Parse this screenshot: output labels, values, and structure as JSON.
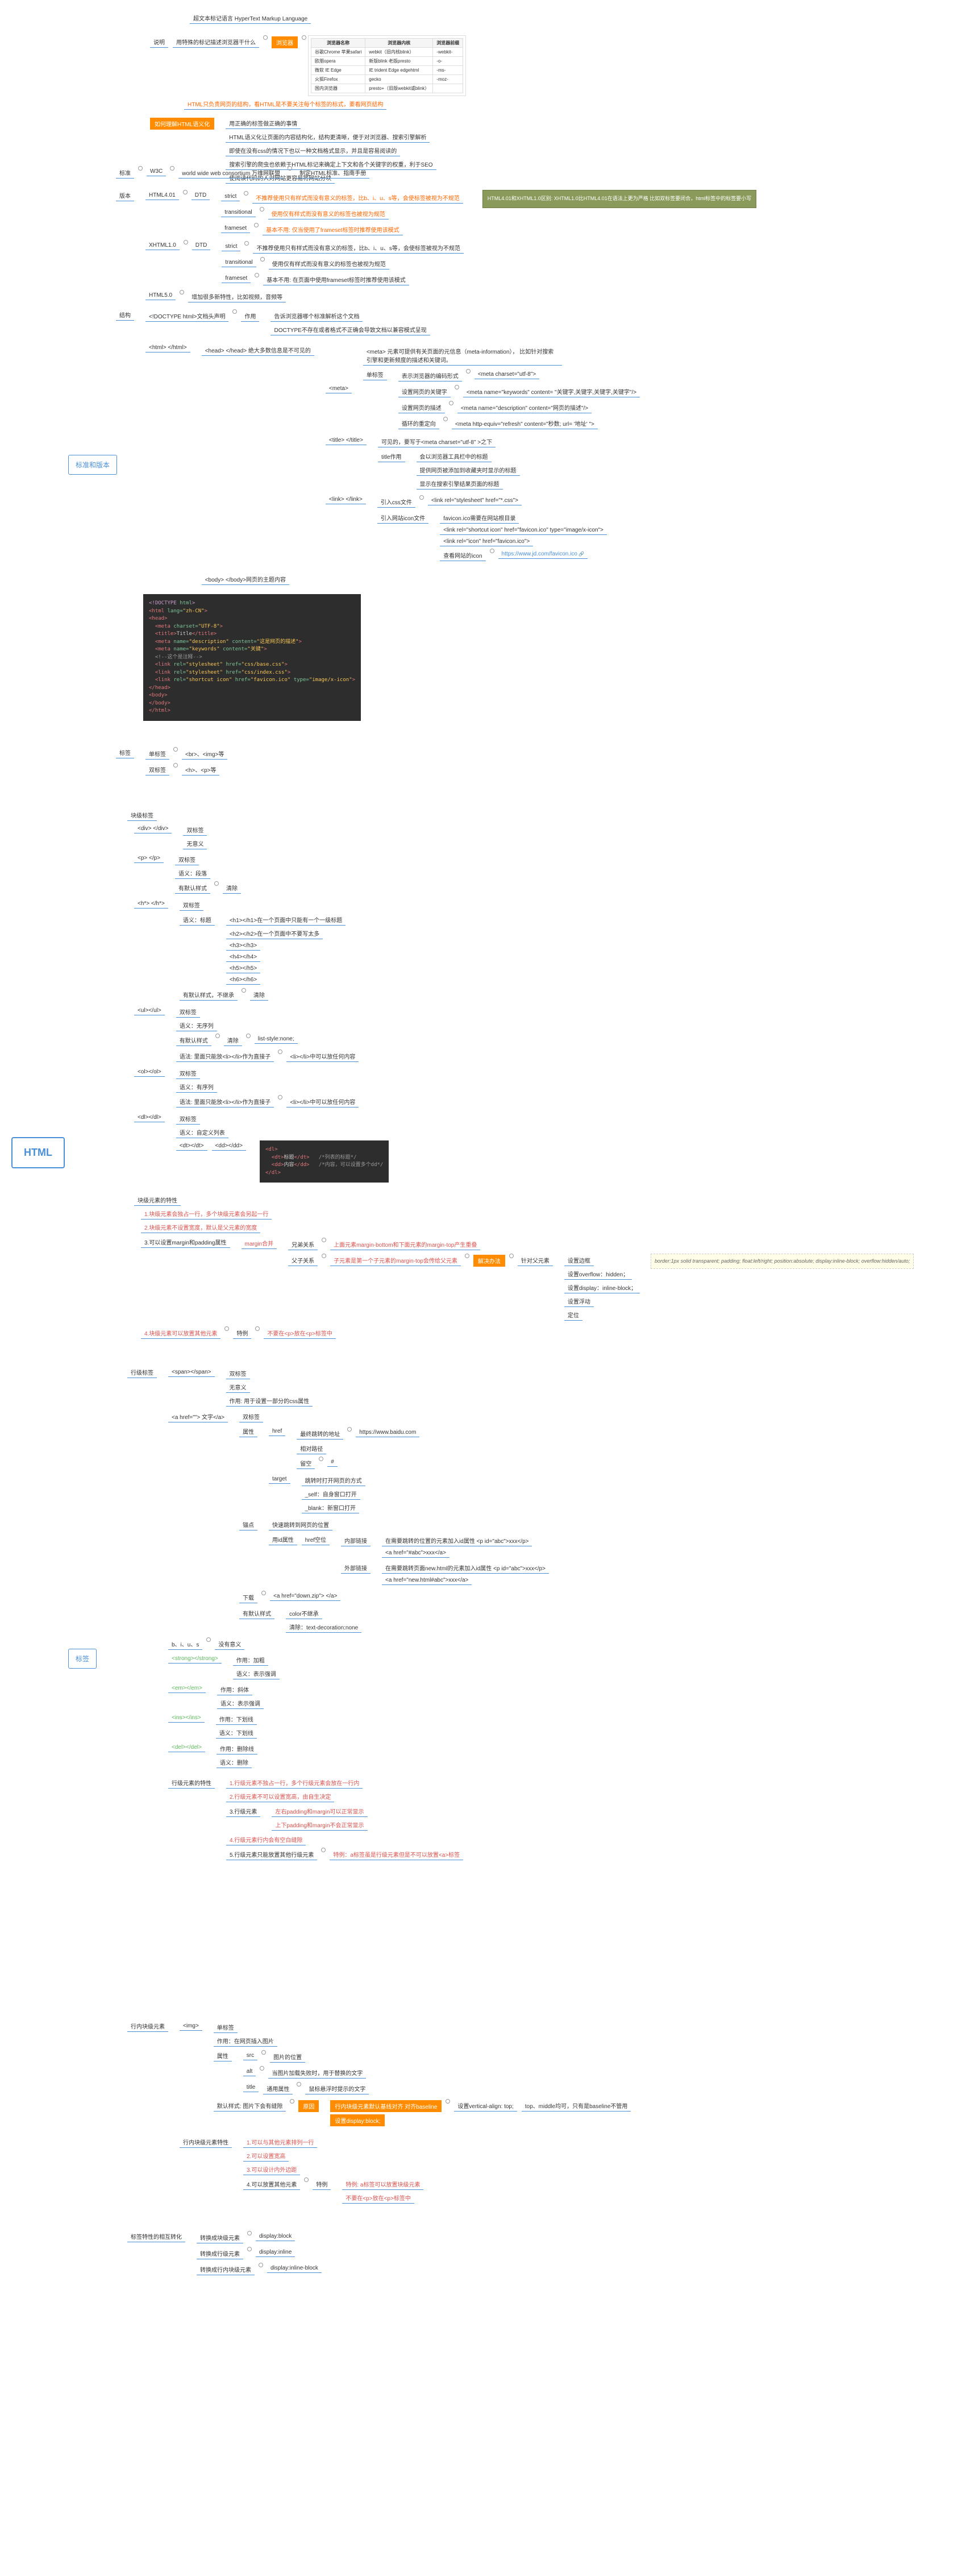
{
  "root": "HTML",
  "main_branches": {
    "standards": "标准和版本",
    "tags": "标签"
  },
  "standards": {
    "title": "超文本标记语言 HyperText Markup Language",
    "desc_label": "说明",
    "desc": "用特殊的标记描述浏览器干什么",
    "browser_btn": "浏览器",
    "browser_note": "HTML只负责网页的结构，看HTML是不要关注每个标签的标式，要看网页结构",
    "how_understand": "如何理解HTML语义化",
    "semantic": {
      "l1": "用正确的标签做正确的事情",
      "l2": "HTML语义化让页面的内容结构化，结构更清晰，便于对浏览器、搜索引擎解析",
      "l3": "即使在没有css的情况下也以一种文档格式显示，并且是容易阅读的",
      "l4": "搜索引擎的爬虫也依赖于HTML标记来确定上下文和各个关键字的权重，利于SEO",
      "l5": "使阅读代码的人对网站更容易将网站分块"
    },
    "std_label": "标准",
    "w3c": "W3C",
    "w3c_full": "world wide web consortium 万维网联盟",
    "std_desc": "制定HTML标准、指南手册",
    "ver_label": "版本",
    "html401": "HTML4.01",
    "xhtml10": "XHTML1.0",
    "html50": "HTML5.0",
    "dtd": "DTD",
    "dtd_items": {
      "strict": "strict",
      "strict_desc": "不推荐使用只有样式而没有意义的标签，比b、i、u、s等，会使标签被视为不规范",
      "transitional": "transitional",
      "trans_desc": "使用仅有样式而没有意义的标签也被视为规范",
      "trans_note": "基本不用: 仅当使用了frameset标签时推荐使用该模式",
      "frameset": "frameset",
      "xstrict_desc": "不推荐使用只有样式而没有意义的标签，比b、i、u、s等，会使标签被视为不规范",
      "xtrans_desc": "使用仅有样式而没有意义的标签也被视为规范",
      "xframe_desc": "基本不用: 在页面中使用frameset标签时推荐使用该模式"
    },
    "html5_desc": "增加很多新特性，比如视频，音频等",
    "green_note": "HTML4.01和XHTML1.0区别:\nXHTML1.0比HTML4.01在语法上更为严格\n比如双标签要闭合，html标签中的标签要小写",
    "struct_label": "结构",
    "doctype": "<!DOCTYPE html>文档头声明",
    "doctype_use": "作用",
    "doctype_d1": "告诉浏览器哪个标准解析这个文档",
    "doctype_d2": "DOCTYPE不存在或者格式不正确会导致文档以兼容模式呈现",
    "html_tag": "<html> </html>",
    "head_tag": "<head> </head> 绝大多数信息是不可见的",
    "body_tag": "<body> </body>网页的主题内容",
    "meta_tag": "<meta>",
    "meta_desc": "<meta> 元素可提供有关页面的元信息（meta-information），\n比如针对搜索引擎和更新频度的描述和关键词。",
    "single_tag": "单标签",
    "meta_charset_l": "表示浏览器的编码形式",
    "meta_charset_v": "<meta charset=\"utf-8\">",
    "meta_kw_l": "设置网页的关键字",
    "meta_kw_v": "<meta name=\"keywords\" content= \"关键字,关键字,关键字,关键字\"/>",
    "meta_desc_l": "设置网页的描述",
    "meta_desc_v": "<meta name=\"description\" content=\"网页的描述\"/>",
    "meta_refresh_l": "循环的重定向",
    "meta_refresh_v": "<meta http-equiv=\"refresh\" content=\"秒数; url= '地址' \">",
    "title_tag": "<title> </title>",
    "title_l1": "可见的，要写于<meta charset=\"utf-8\" >之下",
    "title_d1": "会以浏览器工具栏中的标题",
    "title_label": "title作用",
    "title_d2": "提供网页被添加到收藏夹时显示的标题",
    "title_d3": "显示在搜索引擎结果页面的标题",
    "link_tag": "<link> </link>",
    "link_css_l": "引入css文件",
    "link_css_v": "<link rel=\"stylesheet\" href=\"*.css\">",
    "link_fav_l": "引入网站icon文件",
    "link_fav_d": "favicon.ico需要在网站根目录",
    "link_fav_v1": "<link rel=\"shortcut icon\" href=\"favicon.ico\" type=\"image/x-icon\">",
    "link_fav_v2": "<link rel=\"icon\" href=\"favicon.ico\">",
    "link_fav_see": "查看网站的icon",
    "link_fav_url": "https://www.jd.com/favicon.ico",
    "tag_class_label": "标签",
    "single": "单标签",
    "single_eg": "<br>、<img>等",
    "double": "双标签",
    "double_eg": "<h>、<p>等",
    "browser_table": {
      "headers": [
        "浏览器名称",
        "浏览器内核",
        "浏览器前缀"
      ],
      "rows": [
        [
          "谷歌Chrome 苹果safari",
          "webkit（旧内核blink）",
          "-webkit-"
        ],
        [
          "欧朋opera",
          "新版blink 老版presto",
          "-o-"
        ],
        [
          "微软 IE Edge",
          "IE trident Edge edgehtml",
          "-ms-"
        ],
        [
          "火狐Firefox",
          "gecko",
          "-moz-"
        ],
        [
          "国内浏览器",
          "presto+（旧版webkit或blink）",
          ""
        ]
      ]
    }
  },
  "tags": {
    "block_label": "块级标签",
    "div": {
      "tag": "<div> </div>",
      "t1": "双标签",
      "t2": "无意义"
    },
    "p": {
      "tag": "<p> </p>",
      "t1": "双标签",
      "t2": "语义：段落",
      "d1": "有默认样式",
      "d2": "清除"
    },
    "h": {
      "tag": "<h*> </h*>",
      "t1": "双标签",
      "m": "语义：标题",
      "h1": "<h1></h1>在一个页面中只能有一个一级标题",
      "h2": "<h2></h2>在一个页面中不要写太多",
      "h3": "<h3></h3>",
      "h4": "<h4></h4>",
      "h5": "<h5></h5>",
      "h6": "<h6></h6>",
      "d1": "有默认样式，不继承",
      "d2": "清除"
    },
    "ul": {
      "tag": "<ul></ul>",
      "t1": "双标签",
      "m": "语义：无序列",
      "d1": "有默认样式",
      "d2": "清除",
      "d3": "list-style:none;",
      "n": "语法: 里面只能放<li></li>作为直接子",
      "n2": "<li></li>中可以放任何内容"
    },
    "ol": {
      "tag": "<ol></ol>",
      "t1": "双标签",
      "m": "语义：有序列",
      "n": "语法: 里面只能放<li></li>作为直接子",
      "n2": "<li></li>中可以放任何内容"
    },
    "dl": {
      "tag": "<dl></dl>",
      "t1": "双标签",
      "m": "语义：自定义列表",
      "dt": "<dt></dt>",
      "dd": "<dd></dd>"
    },
    "block_feature_label": "块级元素的特性",
    "bf1": "1.块级元素会独占一行，多个块级元素会另起一行",
    "bf2": "2.块级元素不设置宽度，默认是父元素的宽度",
    "bf3": "3.可以设置margin和padding属性",
    "bf4": "4.块级元素可以放置其他元素",
    "bf4_sp": "特例",
    "bf4_sp_v": "不要在<p>放在<p>标签中",
    "margin_label": "margin合并",
    "margin_bro": "兄弟关系",
    "margin_bro_v": "上面元素margin-bottom和下面元素的margin-top产生重叠",
    "margin_par": "父子关系",
    "margin_par_v": "子元素是第一个子元素的margin-top会传给父元素",
    "solve": "解决办法",
    "solve_l": "针对父元素",
    "solve1": "设置边框",
    "solve2": "设置overflow：hidden；",
    "solve3": "设置display：inline-block；",
    "solve4": "设置浮动",
    "solve5": "定位",
    "solve_note": "border:1px solid transparent;\npadding;\nfloat:left/right;\nposition:absolute;\ndisplay:inline-block;\noverflow:hidden/auto;",
    "inline_label": "行级标签",
    "span": {
      "tag": "<span></span>",
      "t1": "双标签",
      "t2": "无意义",
      "d": "作用: 用于设置一部分的css属性"
    },
    "a": {
      "tag": "<a href=\"\"> 文字</a>",
      "t1": "双标签",
      "attr_l": "属性",
      "href": "href",
      "href_abs": "最终跳转的地址",
      "href_abs_v": "https://www.baidu.com",
      "href_rel": "相对路径",
      "href_empty": "留空",
      "href_empty_v": "#",
      "target": "target",
      "target_d": "跳转时打开网页的方式",
      "target_self": "_self：自身窗口打开",
      "target_blank": "_blank：新窗口打开",
      "anchor": "锚点",
      "anchor_d": "快速跳转到网页的位置",
      "anchor_use": "用id属性",
      "anchor_href": "href空位",
      "anchor_in": "内部链接",
      "anchor_in_v": "在需要跳转的位置的元素加入id属性 <p id=\"abc\">xxx</p>",
      "anchor_in_v2": "<a href=\"#abc\">xxx</a>",
      "anchor_out": "外部链接",
      "anchor_out_v": "在需要跳转页面new.html的元素加入id属性 <p id=\"abc\">xxx</p>",
      "anchor_out_v2": "<a href=\"new.html#abc\">xxx</a>",
      "download": "下载",
      "download_v": "<a href=\"down.zip\"> </a>",
      "style_l": "有默认样式",
      "style_c": "color不继承",
      "style_d": "清除：text-decoration:none"
    },
    "bius": {
      "tag": "b、i、u、s",
      "d": "没有意义"
    },
    "strong": {
      "tag": "<strong></strong>",
      "u": "作用：加粗",
      "m": "语义：表示强调"
    },
    "em": {
      "tag": "<em></em>",
      "u": "作用：斜体",
      "m": "语义：表示强调"
    },
    "ins": {
      "tag": "<ins></ins>",
      "u": "作用：下划线",
      "m": "语义：下划线"
    },
    "del": {
      "tag": "<del></del>",
      "u": "作用：删除线",
      "m": "语义：删除"
    },
    "inline_feature_label": "行级元素的特性",
    "if1": "1.行级元素不独占一行，多个行级元素会放在一行内",
    "if2": "2.行级元素不可以设置宽高，由自生决定",
    "if3": "3.行级元素",
    "if3a": "左右padding和margin可以正常显示",
    "if3b": "上下padding和margin不会正常显示",
    "if4": "4.行级元素行内会有空白缝隙",
    "if5": "5.行级元素只能放置其他行级元素",
    "if5_sp": "特例：a标签虽是行级元素但是不可以放置<a>标签",
    "inlineblock_label": "行内块级元素",
    "img": {
      "tag": "<img>",
      "t": "单标签",
      "d": "作用：在网页插入图片",
      "attr": "属性",
      "src": "src",
      "src_d": "图片的位置",
      "alt": "alt",
      "alt_d": "当图片加载失败时，用于替换的文字",
      "title": "title",
      "title_l": "通用属性",
      "title_d": "鼠标悬浮时提示的文字",
      "style": "默认样式: 图片下会有缝隙",
      "cause": "原因",
      "cause1": "行内块级元素默认基线对齐 对齐baseline",
      "cause2": "设置display:block;",
      "va": "设置vertical-align: top;",
      "va_d": "top、middle均可，只有是baseline不管用"
    },
    "ibf_label": "行内块级元素特性",
    "ibf1": "1.可以与其他元素排列一行",
    "ibf2": "2.可以设置宽高",
    "ibf3": "3.可以设计内外边距",
    "ibf4": "4.可以放置其他元素",
    "ibf4_sp": "特例",
    "ibf4_sp1": "特例: a标签可以放置块级元素",
    "ibf4_sp2": "不要在<p>放在<p>标签中",
    "convert_label": "标签特性的相互转化",
    "c1": "转换成块级元素",
    "c1v": "display:block",
    "c2": "转换成行级元素",
    "c2v": "display:inline",
    "c3": "转换成行内块级元素",
    "c3v": "display:inline-block"
  }
}
